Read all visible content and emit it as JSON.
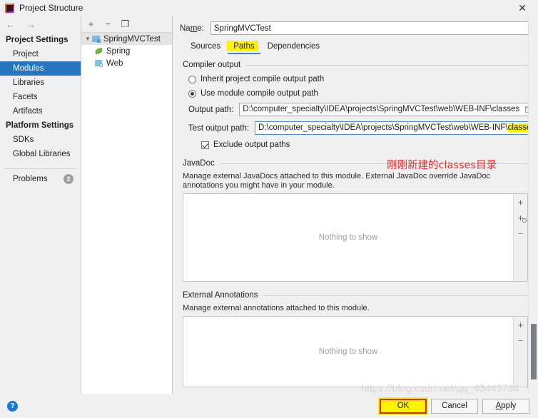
{
  "window": {
    "title": "Project Structure",
    "close_label": "✕",
    "app_icon": "intellij-idea-icon"
  },
  "nav": {
    "back_icon": "←",
    "forward_icon": "→",
    "groups": [
      {
        "title": "Project Settings",
        "items": [
          {
            "label": "Project",
            "selected": false
          },
          {
            "label": "Modules",
            "selected": true
          },
          {
            "label": "Libraries",
            "selected": false
          },
          {
            "label": "Facets",
            "selected": false
          },
          {
            "label": "Artifacts",
            "selected": false
          }
        ]
      },
      {
        "title": "Platform Settings",
        "items": [
          {
            "label": "SDKs",
            "selected": false
          },
          {
            "label": "Global Libraries",
            "selected": false
          }
        ]
      }
    ],
    "problems": {
      "label": "Problems",
      "count": "2"
    }
  },
  "tree": {
    "toolbar": {
      "add": "+",
      "remove": "−",
      "copy": "❐"
    },
    "nodes": [
      {
        "label": "SpringMVCTest",
        "icon": "module-icon",
        "level": 0,
        "expanded": true,
        "selected": true
      },
      {
        "label": "Spring",
        "icon": "spring-leaf-icon",
        "level": 1,
        "selected": false
      },
      {
        "label": "Web",
        "icon": "web-facet-icon",
        "level": 1,
        "selected": false
      }
    ]
  },
  "module": {
    "name_label": "Name:",
    "name_label_pre": "Na",
    "name_label_mnemonic": "m",
    "name_label_post": "e:",
    "name_value": "SpringMVCTest",
    "tabs": [
      {
        "label": "Sources",
        "active": false
      },
      {
        "label": "Paths",
        "active": true,
        "highlighted": true
      },
      {
        "label": "Dependencies",
        "active": false
      }
    ],
    "compiler_output": {
      "title": "Compiler output",
      "inherit_label": "Inherit project compile output path",
      "inherit_selected": false,
      "use_module_label": "Use module compile output path",
      "use_module_selected": true,
      "output_path_label": "Output path:",
      "output_path_value": "D:\\computer_specialty\\IDEA\\projects\\SpringMVCTest\\web\\WEB-INF\\classes",
      "test_output_path_label": "Test output path:",
      "test_output_prefix": "D:\\computer_specialty\\IDEA\\projects\\SpringMVCTest\\web\\WEB-INF\\",
      "test_output_highlight": "classes",
      "test_output_caret_after": "D:",
      "exclude_label": "Exclude output paths",
      "exclude_checked": true,
      "browse_icon": "folder-browse-icon"
    },
    "javadoc": {
      "title": "JavaDoc",
      "description": "Manage external JavaDocs attached to this module. External JavaDoc override JavaDoc annotations you might have in your module.",
      "empty_text": "Nothing to show",
      "buttons": [
        {
          "icon": "plus-icon",
          "glyph": "+"
        },
        {
          "icon": "add-url-icon",
          "glyph": "+"
        },
        {
          "icon": "minus-icon",
          "glyph": "−"
        }
      ]
    },
    "external_annotations": {
      "title": "External Annotations",
      "description": "Manage external annotations attached to this module.",
      "empty_text": "Nothing to show",
      "buttons": [
        {
          "icon": "plus-icon",
          "glyph": "+"
        },
        {
          "icon": "minus-icon",
          "glyph": "−"
        }
      ]
    }
  },
  "annotations": {
    "classes_note": "刚刚新建的classes目录",
    "note_color": "#ef2b2b",
    "highlight_color": "#fdf200",
    "marker_color": "#d12b2b"
  },
  "footer": {
    "help_glyph": "?",
    "ok_label": "OK",
    "cancel_label": "Cancel",
    "apply_label_pre": "A",
    "apply_label_mnemonic": "A",
    "apply_label": "Apply"
  },
  "watermark": {
    "text": "https://blog.csdn.net/qq_43443734"
  }
}
